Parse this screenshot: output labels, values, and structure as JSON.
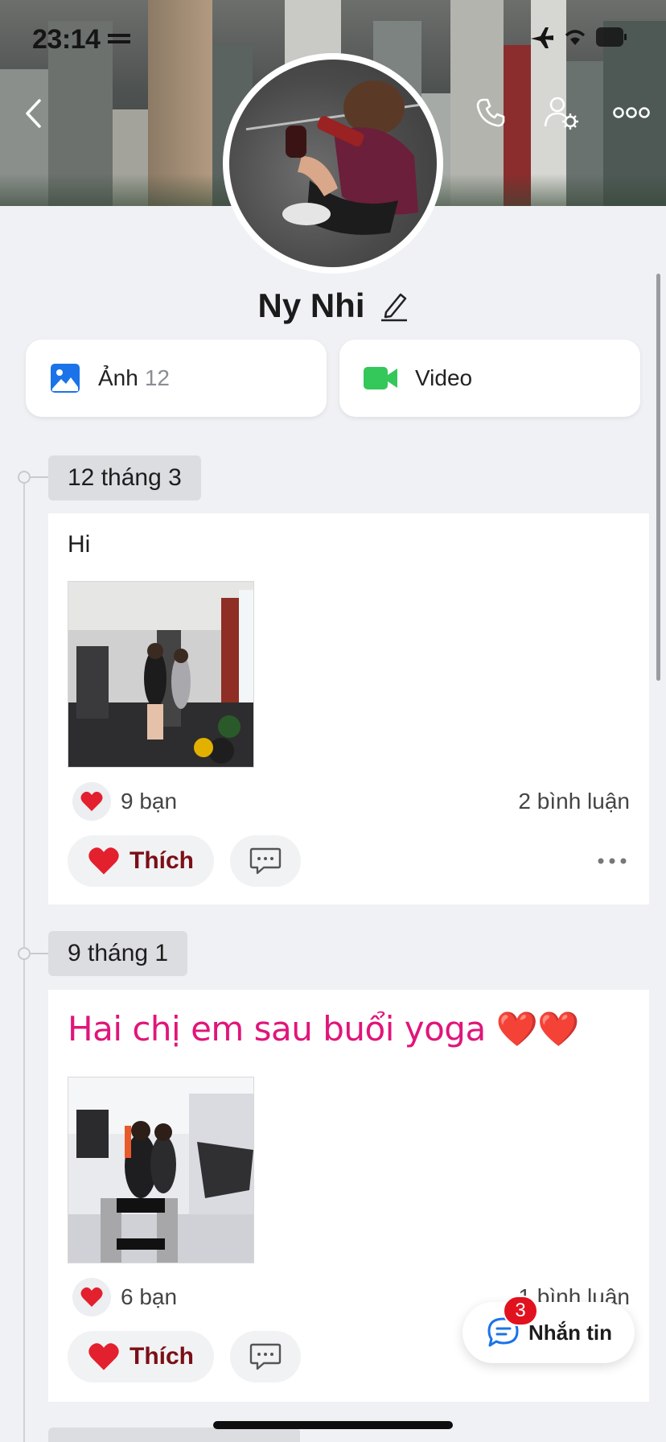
{
  "status_bar": {
    "time": "23:14"
  },
  "profile": {
    "name": "Ny Nhi"
  },
  "media": {
    "photos_label": "Ảnh",
    "photos_count": "12",
    "video_label": "Video"
  },
  "posts": [
    {
      "date": "12 tháng 3",
      "text": "Hi",
      "reactions": "9 bạn",
      "comments": "2 bình luận",
      "like_label": "Thích"
    },
    {
      "date": "9 tháng 1",
      "text": "Hai chị em sau buổi yoga ❤️❤️",
      "reactions": "6 bạn",
      "comments": "1 bình luận",
      "like_label": "Thích"
    }
  ],
  "message_button": {
    "label": "Nhắn tin",
    "badge": "3"
  },
  "colors": {
    "accent_blue": "#1a73e8",
    "video_green": "#34c759",
    "like_red": "#e3202e",
    "pink_text": "#e0157a"
  },
  "icons": [
    "back-icon",
    "phone-icon",
    "user-settings-icon",
    "more-icon",
    "edit-icon",
    "photo-icon",
    "video-icon",
    "heart-icon",
    "comment-icon",
    "chat-icon"
  ]
}
